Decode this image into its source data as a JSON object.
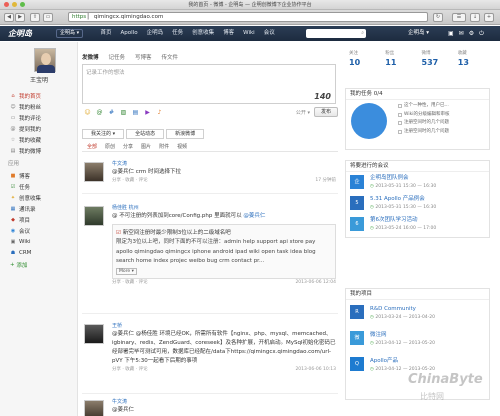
{
  "window": {
    "title": "我的首页 - 微博 - 企明岛 — 企明创微博下企业协作平台"
  },
  "browser": {
    "url_scheme": "https",
    "url_host": "qimingcx.qimingdao.com"
  },
  "nav": {
    "logo": "企明岛",
    "company_button": "企明岛 ▾",
    "items": [
      "首页",
      "Apollo",
      "企明岛",
      "任务",
      "创意收集",
      "博客",
      "Wiki",
      "会议"
    ],
    "company_name": "企明岛 ▾",
    "colors": {
      "bar": "#1d2b3f",
      "accent": "#c0392b",
      "link": "#2a6ebd"
    }
  },
  "sidebar": {
    "user_name": "王宝明",
    "items": [
      {
        "label": "我的首页",
        "icon": "home-icon",
        "active": true
      },
      {
        "label": "我的粉丝",
        "icon": "user-icon"
      },
      {
        "label": "我的评论",
        "icon": "comment-icon"
      },
      {
        "label": "提到我的",
        "icon": "at-icon"
      },
      {
        "label": "我的收藏",
        "icon": "star-icon"
      },
      {
        "label": "我的微博",
        "icon": "post-icon"
      }
    ],
    "apps_heading": "应用",
    "apps": [
      {
        "label": "博客",
        "icon": "blog-icon"
      },
      {
        "label": "任务",
        "icon": "task-icon"
      },
      {
        "label": "创意收集",
        "icon": "idea-icon"
      },
      {
        "label": "通讯录",
        "icon": "contacts-icon"
      },
      {
        "label": "项目",
        "icon": "project-icon"
      },
      {
        "label": "会议",
        "icon": "meeting-icon"
      },
      {
        "label": "Wiki",
        "icon": "wiki-icon"
      },
      {
        "label": "CRM",
        "icon": "crm-icon"
      }
    ],
    "add_label": "添加"
  },
  "composer": {
    "tabs": [
      "发微博",
      "记任务",
      "写博客",
      "传文件"
    ],
    "placeholder": "记录工作的想法",
    "count": "140",
    "tool_icons": [
      "emoji-icon",
      "at-icon",
      "hash-icon",
      "image-icon",
      "file-icon",
      "video-icon",
      "music-icon"
    ],
    "access_label": "公开 ▾",
    "publish_label": "发布"
  },
  "feed": {
    "tabs": [
      "我关注的 ▾",
      "全站动态",
      "新浪微博"
    ],
    "filters": [
      "全部",
      "原创",
      "分享",
      "图片",
      "附件",
      "视频"
    ]
  },
  "posts": [
    {
      "name": "牛文涛",
      "text": "@姜兵仁 crm 时间选择下拉",
      "time": "17 分钟前"
    },
    {
      "name": "杨佳胜 杭州",
      "text_pre": "@ 不可注册的列表加到core/Config.php 里面就可以 ",
      "mention": "@姜兵仁",
      "quote_title": "新空间注册时最少限制3位以上的二级域名吧",
      "quote_text": "限定为3位以上吧，同时下面的不可以注册：admin help support api store pay apollo qimingdao qimingcx iphone android ipad wiki open task idea blog search home index projec weibo bug crm contact pr...",
      "more": "More ▾",
      "time": "2013-06-06 12:04"
    },
    {
      "name": "王桥",
      "text": "@姜兵仁 @杨佳胜 环境已经OK，所需所有软件【nginx、php、mysql、memcached、igbinary、redis、ZendGuard、coreseek】及各种扩展，开机启动。MySql初始化密码已经部署完毕可测试可用，数据库已经配在/data下https://qimingcx.qimingdao.com/url-pVY 下午5:30一起看下后期的事项",
      "time": "2013-06-06 10:13"
    },
    {
      "name": "牛文涛",
      "text": "@姜兵仁",
      "time": ""
    }
  ],
  "stats": [
    {
      "label": "关注",
      "value": "10"
    },
    {
      "label": "粉丝",
      "value": "11"
    },
    {
      "label": "微博",
      "value": "537"
    },
    {
      "label": "收藏",
      "value": "13"
    }
  ],
  "tasks": {
    "title": "我的任务 0/4",
    "progress_percent": 0,
    "items": [
      "这个一种性，用户已...",
      "Wiki的分级编辑和审核",
      "注册空间时的几个问题",
      "注册空间时的几个问题"
    ]
  },
  "meetings": {
    "title": "将要进行的会议",
    "items": [
      {
        "title": "企明岛团队例会",
        "date": "2013-05-31  15:30 — 16:30"
      },
      {
        "title": "5.31 Apollo 产品例会",
        "date": "2013-05-31  15:30 — 16:30"
      },
      {
        "title": "第6次团队学习活动",
        "date": "2013-05-24  16:00 — 17:00"
      }
    ]
  },
  "projects": {
    "title": "我的项目",
    "items": [
      {
        "title": "R&D Community",
        "date": "2013-03-24  —  2013-04-20"
      },
      {
        "title": "微注网",
        "date": "2013-04-12  —  2013-05-20"
      },
      {
        "title": "Apollo产品",
        "date": "2013-04-12  —  2013-05-20"
      }
    ]
  },
  "watermark": {
    "line1": "ChinaByte",
    "line2": "比特网"
  }
}
